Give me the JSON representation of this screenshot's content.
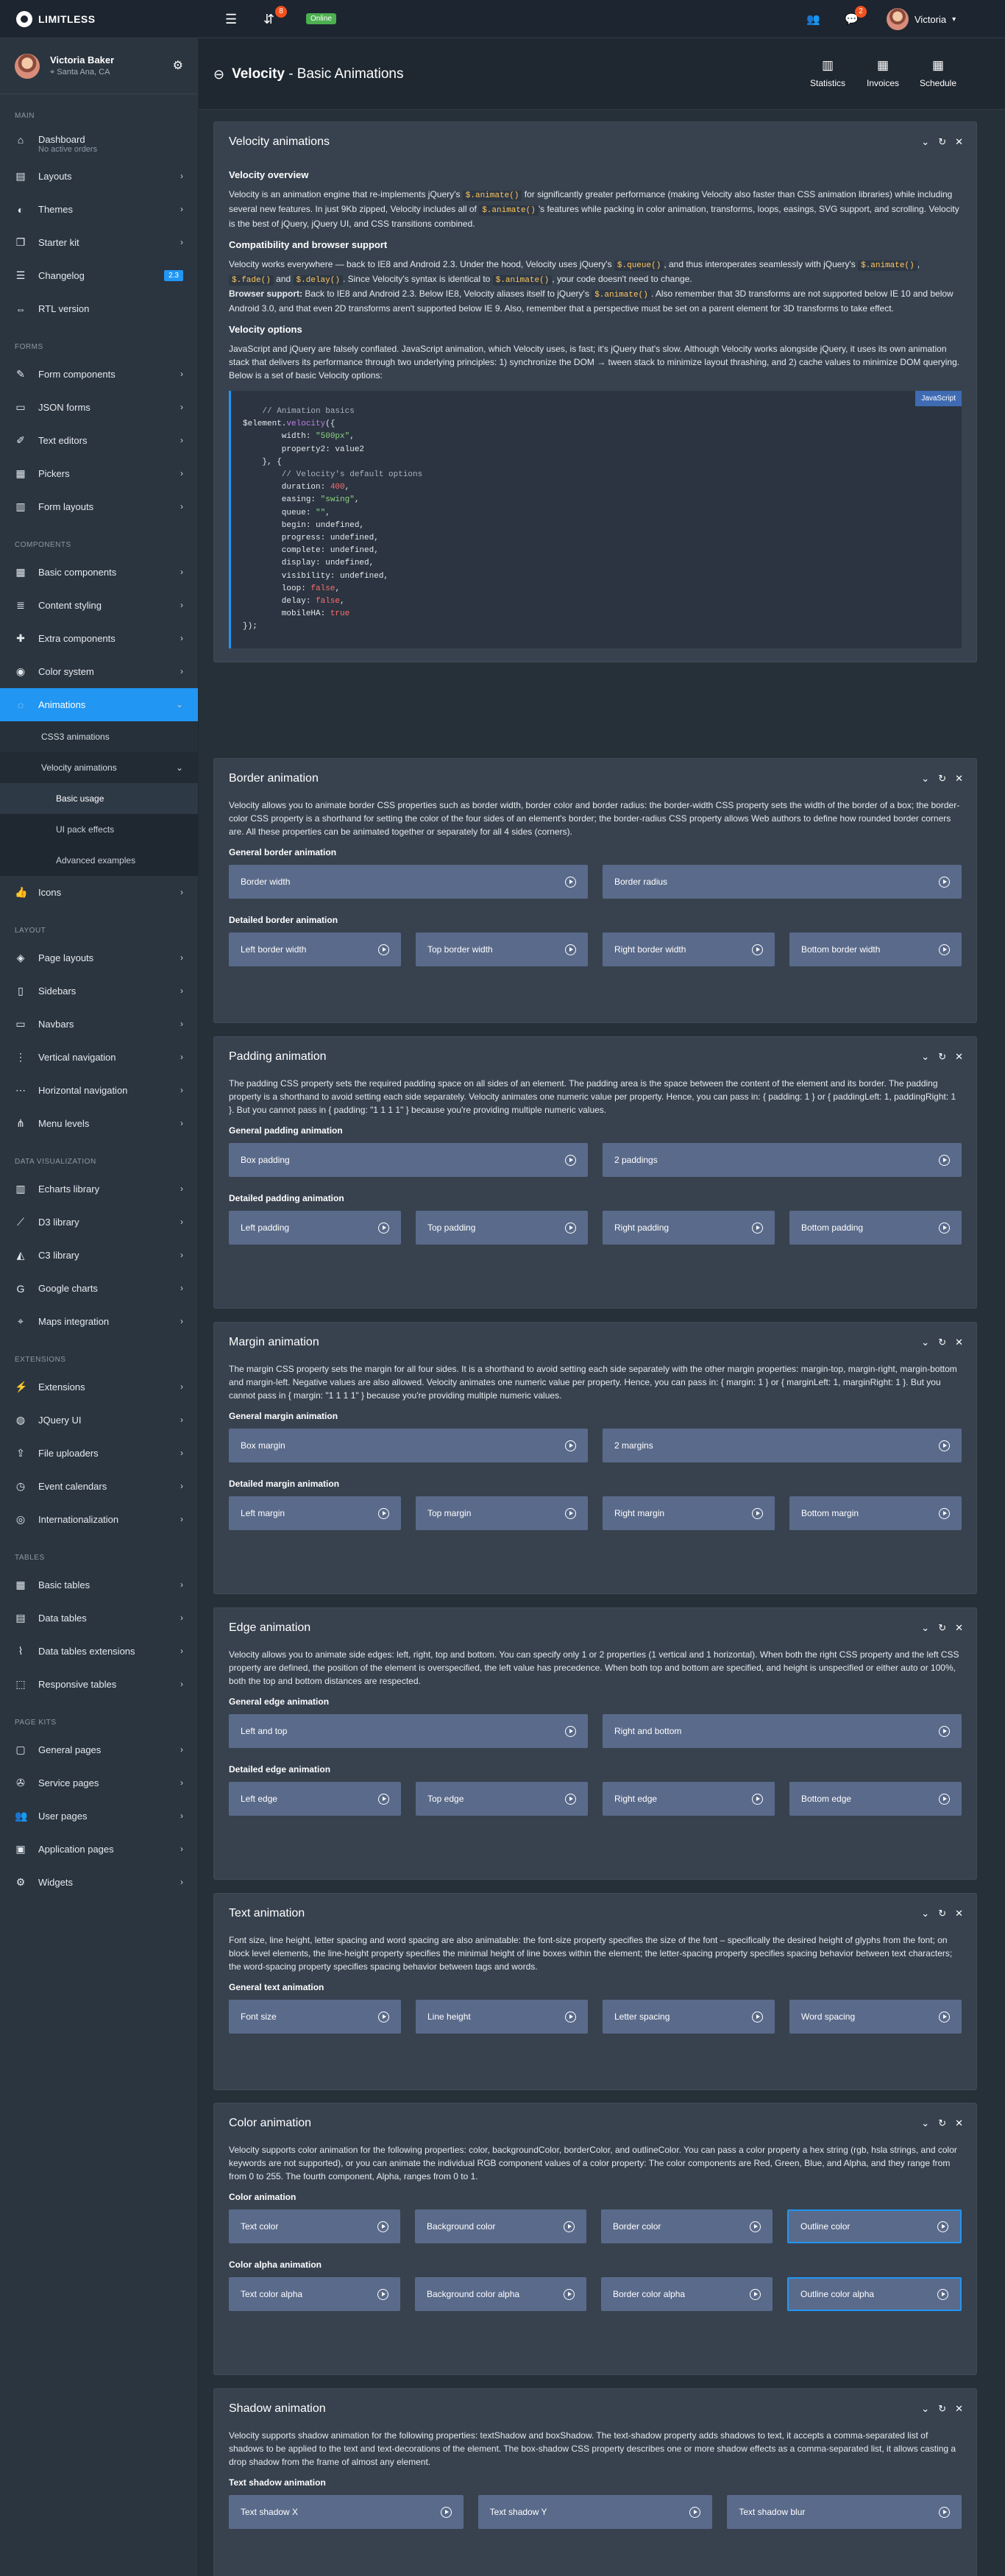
{
  "navbar": {
    "brand": "LIMITLESS",
    "notif_badge": "8",
    "online_label": "Online",
    "msg_badge": "2",
    "user_name": "Victoria"
  },
  "sidebar": {
    "user": {
      "name": "Victoria Baker",
      "location": "Santa Ana, CA"
    },
    "sections": [
      {
        "title": "Main",
        "items": [
          {
            "label": "Dashboard",
            "sub": "No active orders",
            "icon": "home-icon"
          },
          {
            "label": "Layouts",
            "icon": "layout-icon",
            "chev": true
          },
          {
            "label": "Themes",
            "icon": "color-icon",
            "chev": true
          },
          {
            "label": "Starter kit",
            "icon": "copy-icon",
            "chev": true
          },
          {
            "label": "Changelog",
            "icon": "list-icon",
            "badge": "2.3"
          },
          {
            "label": "RTL version",
            "icon": "width-icon"
          }
        ]
      },
      {
        "title": "Forms",
        "items": [
          {
            "label": "Form components",
            "icon": "pencil-icon",
            "chev": true
          },
          {
            "label": "JSON forms",
            "icon": "file-icon",
            "chev": true
          },
          {
            "label": "Text editors",
            "icon": "edit-icon",
            "chev": true
          },
          {
            "label": "Pickers",
            "icon": "calendar-icon",
            "chev": true
          },
          {
            "label": "Form layouts",
            "icon": "form-icon",
            "chev": true
          }
        ]
      },
      {
        "title": "Components",
        "items": [
          {
            "label": "Basic components",
            "icon": "grid-icon",
            "chev": true
          },
          {
            "label": "Content styling",
            "icon": "stack-icon",
            "chev": true
          },
          {
            "label": "Extra components",
            "icon": "puzzle-icon",
            "chev": true
          },
          {
            "label": "Color system",
            "icon": "drop-icon",
            "chev": true
          },
          {
            "label": "Animations",
            "icon": "spinner-icon",
            "chev": true,
            "active": true
          }
        ]
      }
    ],
    "anim_sub": [
      {
        "label": "CSS3 animations"
      },
      {
        "label": "Velocity animations",
        "open": true
      }
    ],
    "velocity_sub": [
      {
        "label": "Basic usage",
        "current": true
      },
      {
        "label": "UI pack effects"
      },
      {
        "label": "Advanced examples"
      }
    ],
    "icons_item": {
      "label": "Icons",
      "icon": "thumbs-up-icon",
      "chev": true
    },
    "sections2": [
      {
        "title": "Layout",
        "items": [
          {
            "label": "Page layouts",
            "icon": "layers-icon",
            "chev": true
          },
          {
            "label": "Sidebars",
            "icon": "sidebar-icon",
            "chev": true
          },
          {
            "label": "Navbars",
            "icon": "navbar-icon",
            "chev": true
          },
          {
            "label": "Vertical navigation",
            "icon": "vertical-nav-icon",
            "chev": true
          },
          {
            "label": "Horizontal navigation",
            "icon": "horizontal-nav-icon",
            "chev": true
          },
          {
            "label": "Menu levels",
            "icon": "tree-icon",
            "chev": true
          }
        ]
      },
      {
        "title": "Data visualization",
        "items": [
          {
            "label": "Echarts library",
            "icon": "chart-icon",
            "chev": true
          },
          {
            "label": "D3 library",
            "icon": "line-chart-icon",
            "chev": true
          },
          {
            "label": "C3 library",
            "icon": "area-chart-icon",
            "chev": true
          },
          {
            "label": "Google charts",
            "icon": "google-icon",
            "chev": true
          },
          {
            "label": "Maps integration",
            "icon": "map-icon",
            "chev": true
          }
        ]
      },
      {
        "title": "Extensions",
        "items": [
          {
            "label": "Extensions",
            "icon": "plug-icon",
            "chev": true
          },
          {
            "label": "JQuery UI",
            "icon": "jquery-icon",
            "chev": true
          },
          {
            "label": "File uploaders",
            "icon": "upload-icon",
            "chev": true
          },
          {
            "label": "Event calendars",
            "icon": "event-icon",
            "chev": true
          },
          {
            "label": "Internationalization",
            "icon": "globe-icon",
            "chev": true
          }
        ]
      },
      {
        "title": "Tables",
        "items": [
          {
            "label": "Basic tables",
            "icon": "table-icon",
            "chev": true
          },
          {
            "label": "Data tables",
            "icon": "data-table-icon",
            "chev": true
          },
          {
            "label": "Data tables extensions",
            "icon": "brush-icon",
            "chev": true
          },
          {
            "label": "Responsive tables",
            "icon": "responsive-icon",
            "chev": true
          }
        ]
      },
      {
        "title": "Page kits",
        "items": [
          {
            "label": "General pages",
            "icon": "page-icon",
            "chev": true
          },
          {
            "label": "Service pages",
            "icon": "wrench-icon",
            "chev": true
          },
          {
            "label": "User pages",
            "icon": "users-icon",
            "chev": true
          },
          {
            "label": "Application pages",
            "icon": "app-icon",
            "chev": true
          },
          {
            "label": "Widgets",
            "icon": "gear-icon",
            "chev": true
          }
        ]
      }
    ]
  },
  "page_header": {
    "title_bold": "Velocity",
    "title_rest": " - Basic Animations",
    "buttons": [
      {
        "label": "Statistics",
        "icon": "chart-icon"
      },
      {
        "label": "Invoices",
        "icon": "calculator-icon"
      },
      {
        "label": "Schedule",
        "icon": "calendar-icon"
      }
    ]
  },
  "overview_card": {
    "title": "Velocity animations",
    "h_overview": "Velocity overview",
    "p_overview": [
      "Velocity is an animation engine that re-implements jQuery's ",
      "$.animate()",
      " for significantly greater performance (making Velocity also faster than CSS animation libraries) while including several new features. In just 9Kb zipped, Velocity includes all of ",
      "$.animate()",
      "'s features while packing in color animation, transforms, loops, easings, SVG support, and scrolling. Velocity is the best of jQuery, jQuery UI, and CSS transitions combined."
    ],
    "h_compat": "Compatibility and browser support",
    "p_compat": [
      "Velocity works everywhere — back to IE8 and Android 2.3. Under the hood, Velocity uses jQuery's ",
      "$.queue()",
      ", and thus interoperates seamlessly with jQuery's ",
      "$.animate()",
      ", ",
      "$.fade()",
      " and ",
      "$.delay()",
      ". Since Velocity's syntax is identical to ",
      "$.animate()",
      ", your code doesn't need to change."
    ],
    "compat_strong": "Browser support:",
    "p_compat2": [
      " Back to IE8 and Android 2.3. Below IE8, Velocity aliases itself to jQuery's ",
      "$.animate()",
      ". Also remember that 3D transforms are not supported below IE 10 and below Android 3.0, and that even 2D transforms aren't supported below IE 9. Also, remember that a perspective must be set on a parent element for 3D transforms to take effect."
    ],
    "h_options": "Velocity options",
    "p_options": "JavaScript and jQuery are falsely conflated. JavaScript animation, which Velocity uses, is fast; it's jQuery that's slow. Although Velocity works alongside jQuery, it uses its own animation stack that delivers its performance through two underlying principles: 1) synchronize the DOM → tween stack to minimize layout thrashing, and 2) cache values to minimize DOM querying. Below is a set of basic Velocity options:",
    "code_lang": "JavaScript",
    "code_lines": [
      [
        [
          "c-cmt",
          "    // Animation basics"
        ]
      ],
      [
        [
          "",
          "$element."
        ],
        [
          "c-kw",
          "velocity"
        ],
        [
          "",
          "({"
        ]
      ],
      [
        [
          "",
          "        width: "
        ],
        [
          "c-str",
          "\"500px\""
        ],
        [
          "",
          ","
        ]
      ],
      [
        [
          "",
          "        property2: value2"
        ]
      ],
      [
        [
          "",
          "    }, {"
        ]
      ],
      [
        [
          "c-cmt",
          "        // Velocity's default options"
        ]
      ],
      [
        [
          "",
          "        duration: "
        ],
        [
          "c-num",
          "400"
        ],
        [
          "",
          ","
        ]
      ],
      [
        [
          "",
          "        easing: "
        ],
        [
          "c-str",
          "\"swing\""
        ],
        [
          "",
          ","
        ]
      ],
      [
        [
          "",
          "        queue: "
        ],
        [
          "c-str",
          "\"\""
        ],
        [
          "",
          ","
        ]
      ],
      [
        [
          "",
          "        begin: undefined,"
        ]
      ],
      [
        [
          "",
          "        progress: undefined,"
        ]
      ],
      [
        [
          "",
          "        complete: undefined,"
        ]
      ],
      [
        [
          "",
          "        display: undefined,"
        ]
      ],
      [
        [
          "",
          "        visibility: undefined,"
        ]
      ],
      [
        [
          "",
          "        loop: "
        ],
        [
          "c-num",
          "false"
        ],
        [
          "",
          ","
        ]
      ],
      [
        [
          "",
          "        delay: "
        ],
        [
          "c-num",
          "false"
        ],
        [
          "",
          ","
        ]
      ],
      [
        [
          "",
          "        mobileHA: "
        ],
        [
          "c-num",
          "true"
        ]
      ],
      [
        [
          "",
          "});"
        ]
      ]
    ]
  },
  "demo_cards": [
    {
      "title": "Border animation",
      "text": "Velocity allows you to animate border CSS properties such as border width, border color and border radius: the border-width CSS property sets the width of the border of a box; the border-color CSS property is a shorthand for setting the color of the four sides of an element's border; the border-radius CSS property allows Web authors to define how rounded border corners are. All these properties can be animated together or separately for all 4 sides (corners).",
      "groups": [
        {
          "title": "General border animation",
          "buttons": [
            "Border width",
            "Border radius"
          ]
        },
        {
          "title": "Detailed border animation",
          "buttons": [
            "Left border width",
            "Top border width",
            "Right border width",
            "Bottom border width"
          ]
        }
      ]
    },
    {
      "title": "Padding animation",
      "text": "The padding CSS property sets the required padding space on all sides of an element. The padding area is the space between the content of the element and its border. The padding property is a shorthand to avoid setting each side separately. Velocity animates one numeric value per property. Hence, you can pass in: { padding: 1 } or { paddingLeft: 1, paddingRight: 1 }. But you cannot pass in { padding: \"1 1 1 1\" } because you're providing multiple numeric values.",
      "groups": [
        {
          "title": "General padding animation",
          "buttons": [
            "Box padding",
            "2 paddings"
          ]
        },
        {
          "title": "Detailed padding animation",
          "buttons": [
            "Left padding",
            "Top padding",
            "Right padding",
            "Bottom padding"
          ]
        }
      ]
    },
    {
      "title": "Margin animation",
      "text": "The margin CSS property sets the margin for all four sides. It is a shorthand to avoid setting each side separately with the other margin properties: margin-top, margin-right, margin-bottom and margin-left. Negative values are also allowed. Velocity animates one numeric value per property. Hence, you can pass in: { margin: 1 } or { marginLeft: 1, marginRight: 1 }. But you cannot pass in { margin: \"1 1 1 1\" } because you're providing multiple numeric values.",
      "groups": [
        {
          "title": "General margin animation",
          "buttons": [
            "Box margin",
            "2 margins"
          ]
        },
        {
          "title": "Detailed margin animation",
          "buttons": [
            "Left margin",
            "Top margin",
            "Right margin",
            "Bottom margin"
          ]
        }
      ]
    },
    {
      "title": "Edge animation",
      "text": "Velocity allows you to animate side edges: left, right, top and bottom. You can specify only 1 or 2 properties (1 vertical and 1 horizontal). When both the right CSS property and the left CSS property are defined, the position of the element is overspecified, the left value has precedence. When both top and bottom are specified, and height is unspecified or either auto or 100%, both the top and bottom distances are respected.",
      "groups": [
        {
          "title": "General edge animation",
          "buttons": [
            "Left and top",
            "Right and bottom"
          ]
        },
        {
          "title": "Detailed edge animation",
          "buttons": [
            "Left edge",
            "Top edge",
            "Right edge",
            "Bottom edge"
          ]
        }
      ]
    },
    {
      "title": "Text animation",
      "text": "Font size, line height, letter spacing and word spacing are also animatable: the font-size property specifies the size of the font – specifically the desired height of glyphs from the font; on block level elements, the line-height property specifies the minimal height of line boxes within the element; the letter-spacing property specifies spacing behavior between text characters; the word-spacing property specifies spacing behavior between tags and words.",
      "groups": [
        {
          "title": "General text animation",
          "buttons": [
            "Font size",
            "Line height",
            "Letter spacing",
            "Word spacing"
          ]
        }
      ]
    },
    {
      "title": "Color animation",
      "text": "Velocity supports color animation for the following properties: color, backgroundColor, borderColor, and outlineColor. You can pass a color property a hex string (rgb, hsla strings, and color keywords are not supported), or you can animate the individual RGB component values of a color property: The color components are Red, Green, Blue, and Alpha, and they range from from 0 to 255. The fourth component, Alpha, ranges from 0 to 1.",
      "groups": [
        {
          "title": "Color animation",
          "buttons": [
            "Text color",
            "Background color",
            "Border color",
            "Outline color"
          ],
          "outline_last": true
        },
        {
          "title": "Color alpha animation",
          "buttons": [
            "Text color alpha",
            "Background color alpha",
            "Border color alpha",
            "Outline color alpha"
          ],
          "outline_last": true
        }
      ]
    },
    {
      "title": "Shadow animation",
      "text": "Velocity supports shadow animation for the following properties: textShadow and boxShadow. The text-shadow property adds shadows to text, it accepts a comma-separated list of shadows to be applied to the text and text-decorations of the element. The box-shadow CSS property describes one or more shadow effects as a comma-separated list, it allows casting a drop shadow from the frame of almost any element.",
      "groups": [
        {
          "title": "Text shadow animation",
          "buttons": [
            "Text shadow X",
            "Text shadow Y",
            "Text shadow blur"
          ]
        }
      ]
    }
  ]
}
